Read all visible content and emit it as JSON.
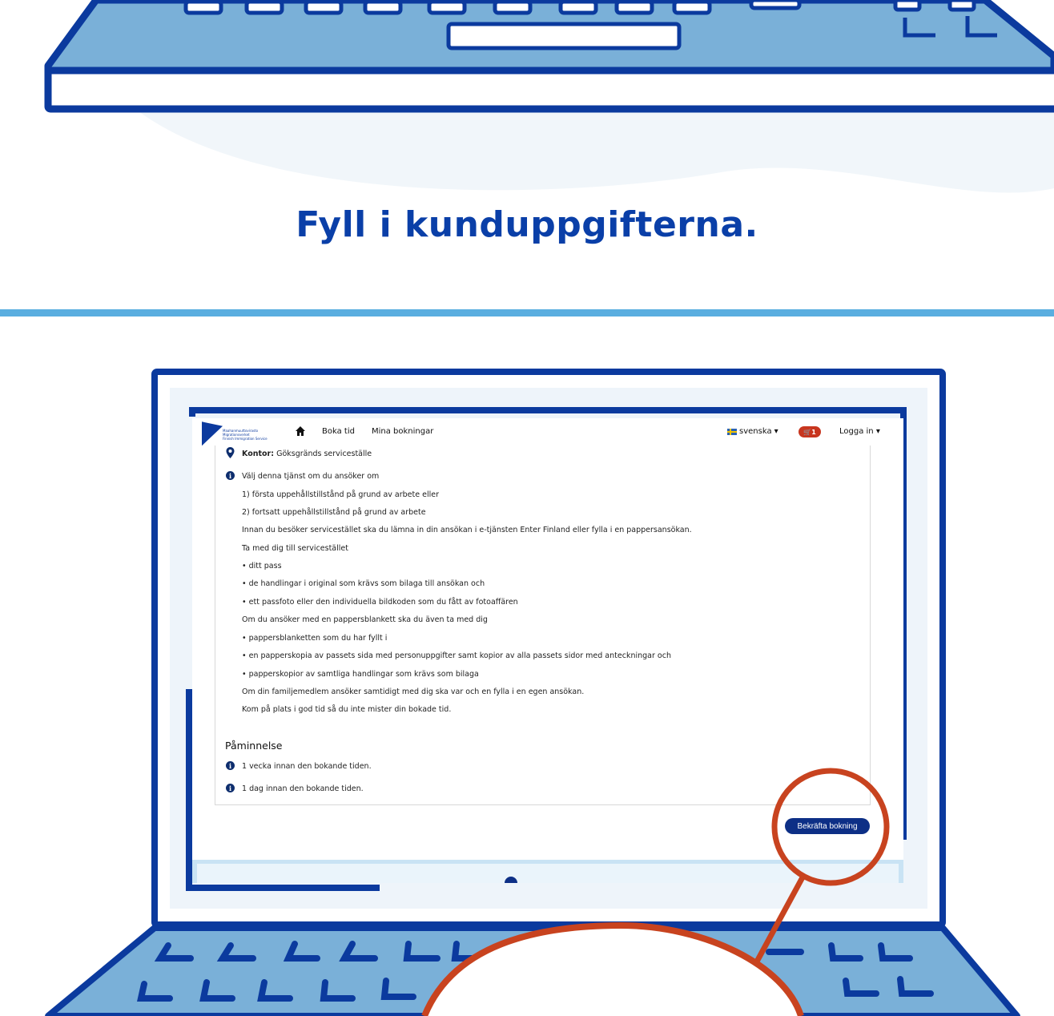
{
  "heading": "Fyll i kunduppgifterna.",
  "nav": {
    "logo_lines": [
      "Maahanmuuttovirasto",
      "Migrationsverket",
      "Finnish Immigration Service"
    ],
    "home_icon": "home-icon",
    "book_time": "Boka tid",
    "my_bookings": "Mina bokningar",
    "language": "svenska",
    "cart_count": "1",
    "login": "Logga in"
  },
  "office": {
    "label": "Kontor:",
    "value": "Göksgränds serviceställe"
  },
  "info": {
    "intro": "Välj denna tjänst om du ansöker om",
    "lines": [
      "1) första uppehållstillstånd på grund av arbete eller",
      "2) fortsatt uppehållstillstånd på grund av arbete",
      "Innan du besöker servicestället ska du lämna in din ansökan i e-tjänsten Enter Finland eller fylla i en pappersansökan.",
      "Ta med dig till servicestället",
      "• ditt pass",
      "• de handlingar i original som krävs som bilaga till ansökan och",
      "• ett passfoto eller den individuella bildkoden som du fått av fotoaffären",
      "Om du ansöker med en pappersblankett ska du även ta med dig",
      "• pappersblanketten som du har fyllt i",
      "• en papperskopia av passets sida med personuppgifter samt kopior av alla passets sidor med anteckningar och",
      "• papperskopior av samtliga handlingar som krävs som bilaga",
      "Om din familjemedlem ansöker samtidigt med dig ska var och en fylla i en egen ansökan.",
      "Kom på plats i god tid så du inte mister din bokade tid."
    ]
  },
  "reminder": {
    "title": "Påminnelse",
    "items": [
      "1 vecka innan den bokande tiden.",
      "1 dag innan den bokande tiden."
    ]
  },
  "confirm_button": "Bekräfta bokning",
  "colors": {
    "brand_blue": "#0a3fa8",
    "keyboard_blue": "#7ab0d8",
    "highlight_red": "#c8431f",
    "divider_blue": "#5aaee0"
  }
}
